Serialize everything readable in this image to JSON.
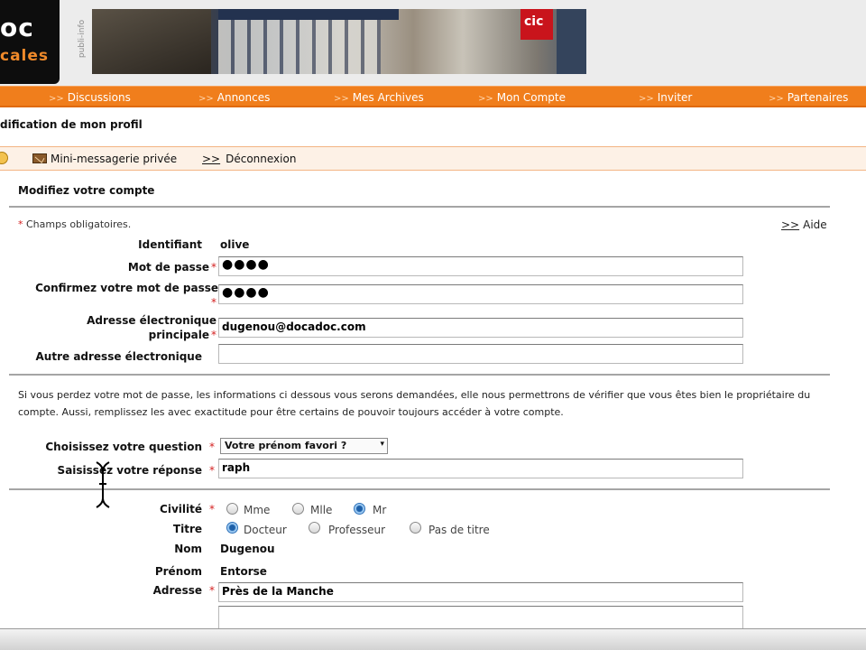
{
  "logo": {
    "line1": "oc",
    "line2": "cales"
  },
  "banner_vertical_text": "publi-info",
  "banner_sign": "cic",
  "nav": [
    {
      "label": "Discussions"
    },
    {
      "label": "Annonces"
    },
    {
      "label": "Mes Archives"
    },
    {
      "label": "Mon Compte"
    },
    {
      "label": "Inviter"
    },
    {
      "label": "Partenaires"
    }
  ],
  "nav_arrow": ">>",
  "page_title": "dification de mon profil",
  "subbar": {
    "messaging": "Mini-messagerie privée",
    "logout_prefix": ">>",
    "logout": "Déconnexion"
  },
  "section_title": "Modifiez votre compte",
  "required_note": "Champs obligatoires.",
  "required_star": "*",
  "help": {
    "prefix": ">>",
    "label": "Aide"
  },
  "fields": {
    "identifiant": {
      "label": "Identifiant",
      "value": "olive"
    },
    "password": {
      "label": "Mot de passe",
      "value": "●●●●"
    },
    "confirm": {
      "label": "Confirmez votre mot de passe",
      "value": "●●●●"
    },
    "email": {
      "label_line1": "Adresse électronique",
      "label_line2": "principale",
      "value": "dugenou@docadoc.com"
    },
    "other_email": {
      "label": "Autre adresse électronique",
      "value": ""
    }
  },
  "info_text": "Si vous perdez votre mot de passe, les informations ci dessous vous serons demandées, elle nous permettrons de vérifier que vous êtes bien le propriétaire du compte. Aussi, remplissez les avec exactitude pour être certains de pouvoir toujours accéder à votre compte.",
  "question": {
    "label": "Choisissez votre question",
    "selected": "Votre prénom favori ?",
    "chevron": "▾"
  },
  "answer": {
    "label": "Saisissez votre réponse",
    "value": "raph"
  },
  "civilite": {
    "label": "Civilité",
    "options": [
      "Mme",
      "Mlle",
      "Mr"
    ],
    "selected": "Mr"
  },
  "titre": {
    "label": "Titre",
    "options": [
      "Docteur",
      "Professeur",
      "Pas de titre"
    ],
    "selected": "Docteur"
  },
  "nom": {
    "label": "Nom",
    "value": "Dugenou"
  },
  "prenom": {
    "label": "Prénom",
    "value": "Entorse"
  },
  "adresse": {
    "label": "Adresse",
    "value": "Près de la Manche",
    "value2": ""
  }
}
